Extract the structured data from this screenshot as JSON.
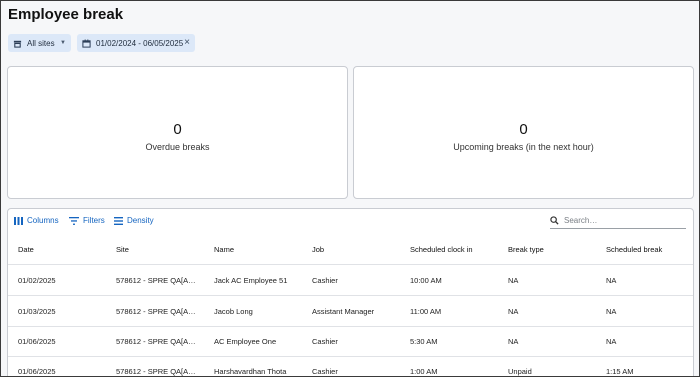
{
  "page": {
    "title": "Employee break"
  },
  "filters": {
    "site": {
      "label": "All sites",
      "icon": "store-icon"
    },
    "date_range": {
      "label": "01/02/2024 - 06/05/2025",
      "icon": "calendar-icon"
    }
  },
  "cards": [
    {
      "value": "0",
      "caption": "Overdue breaks"
    },
    {
      "value": "0",
      "caption": "Upcoming breaks (in the next hour)"
    }
  ],
  "toolbar": {
    "columns_label": "Columns",
    "filters_label": "Filters",
    "density_label": "Density",
    "search_placeholder": "Search…"
  },
  "table": {
    "headers": [
      "Date",
      "Site",
      "Name",
      "Job",
      "Scheduled clock in",
      "Break type",
      "Scheduled break"
    ],
    "rows": [
      [
        "01/02/2025",
        "578612 - SPRE QA[A…",
        "Jack AC Employee 51",
        "Cashier",
        "10:00 AM",
        "NA",
        "NA"
      ],
      [
        "01/03/2025",
        "578612 - SPRE QA[A…",
        "Jacob Long",
        "Assistant Manager",
        "11:00 AM",
        "NA",
        "NA"
      ],
      [
        "01/06/2025",
        "578612 - SPRE QA[A…",
        "AC Employee One",
        "Cashier",
        "5:30 AM",
        "NA",
        "NA"
      ],
      [
        "01/06/2025",
        "578612 - SPRE QA[A…",
        "Harshavardhan Thota",
        "Cashier",
        "1:00 AM",
        "Unpaid",
        "1:15 AM"
      ]
    ]
  },
  "colors": {
    "accent": "#1565c0",
    "chip_bg": "#dce8f8",
    "page_bg": "#f6f7f9"
  }
}
